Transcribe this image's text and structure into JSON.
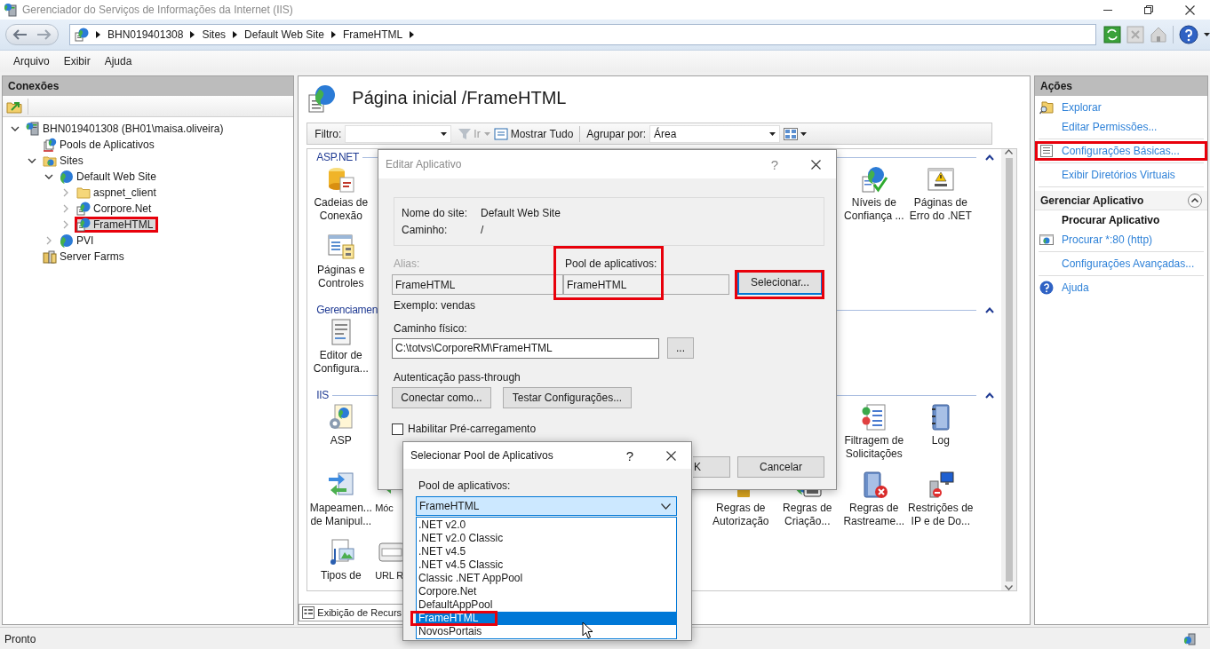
{
  "window": {
    "title": "Gerenciador do Serviços de Informações da Internet (IIS)"
  },
  "address_bar": {
    "breadcrumb": [
      "BHN019401308",
      "Sites",
      "Default Web Site",
      "FrameHTML"
    ]
  },
  "menu": [
    "Arquivo",
    "Exibir",
    "Ajuda"
  ],
  "connections": {
    "title": "Conexões",
    "tree": [
      {
        "label": "BHN019401308 (BH01\\maisa.oliveira)",
        "kind": "server",
        "expanded": true,
        "selected": false,
        "highlighted": false,
        "children": [
          {
            "label": "Pools de Aplicativos",
            "kind": "pools",
            "selected": false,
            "highlighted": false
          },
          {
            "label": "Sites",
            "kind": "sites",
            "expanded": true,
            "selected": false,
            "highlighted": false,
            "children": [
              {
                "label": "Default Web Site",
                "kind": "site",
                "expanded": true,
                "selected": false,
                "highlighted": false,
                "children": [
                  {
                    "label": "aspnet_client",
                    "kind": "folder",
                    "expanded": false,
                    "selected": false,
                    "highlighted": false
                  },
                  {
                    "label": "Corpore.Net",
                    "kind": "app",
                    "expanded": false,
                    "selected": false,
                    "highlighted": false
                  },
                  {
                    "label": "FrameHTML",
                    "kind": "app",
                    "expanded": false,
                    "selected": true,
                    "highlighted": true
                  }
                ]
              },
              {
                "label": "PVI",
                "kind": "site",
                "expanded": false,
                "selected": false,
                "highlighted": false
              }
            ]
          },
          {
            "label": "Server Farms",
            "kind": "farms",
            "selected": false,
            "highlighted": false
          }
        ]
      }
    ]
  },
  "features": {
    "title": "Página inicial /FrameHTML",
    "filter": {
      "label": "Filtro:",
      "go": {
        "label": "Ir",
        "disabled": true
      },
      "show_all": "Mostrar Tudo",
      "group_by_label": "Agrupar por:",
      "group_by_value": "Área"
    },
    "groups": [
      {
        "title": "ASP.NET",
        "expanded": true,
        "items": [
          {
            "label": "Cadeias de\nConexão",
            "kind": "connection-strings"
          },
          {
            "label": "Níveis de\nConfiança ...",
            "kind": "trust"
          },
          {
            "label": "Páginas de\nErro do .NET",
            "kind": "error-pages"
          },
          {
            "label": "Páginas e\nControles",
            "kind": "pages"
          }
        ]
      },
      {
        "title": "Gerenciamen",
        "expanded": true,
        "items": [
          {
            "label": "Editor de\nConfigura...",
            "kind": "config-editor"
          }
        ]
      },
      {
        "title": "IIS",
        "expanded": true,
        "items": [
          {
            "label": "ASP",
            "kind": "asp"
          },
          {
            "label": "Filtragem de\nSolicitações",
            "kind": "request-filtering"
          },
          {
            "label": "Log",
            "kind": "log"
          },
          {
            "label": "Mapeamen...\nde Manipul...",
            "kind": "handler-mappings"
          },
          {
            "label": "Móc",
            "kind": "modules"
          },
          {
            "label": "Regras de\nAutorização",
            "kind": "authorization"
          },
          {
            "label": "Regras de\nCriação...",
            "kind": "webdav"
          },
          {
            "label": "Regras de\nRastreame...",
            "kind": "failed-requests"
          },
          {
            "label": "Restrições de\nIP e de Do...",
            "kind": "ip-restrictions"
          },
          {
            "label": "Tipos de",
            "kind": "mime-types"
          },
          {
            "label": "URL R",
            "kind": "url-rewrite"
          }
        ]
      }
    ],
    "view_tabs": [
      {
        "label": "Exibição de Recurs",
        "selected": true
      }
    ]
  },
  "actions": {
    "title": "Ações",
    "sections": [
      {
        "items": [
          {
            "label": "Explorar",
            "kind": "link",
            "highlighted": false,
            "divider_after": false
          },
          {
            "label": "Editar Permissões...",
            "kind": "link",
            "highlighted": false,
            "divider_after": true
          },
          {
            "label": "Configurações Básicas...",
            "kind": "link",
            "highlighted": true,
            "divider_after": true
          },
          {
            "label": "Exibir Diretórios Virtuais",
            "kind": "link",
            "highlighted": false,
            "divider_after": true
          }
        ]
      },
      {
        "title": "Gerenciar Aplicativo",
        "expanded": true,
        "items": [
          {
            "label": "Procurar Aplicativo",
            "kind": "heading",
            "highlighted": false,
            "divider_after": false
          },
          {
            "label": "Procurar *:80 (http)",
            "kind": "link",
            "highlighted": false,
            "divider_after": true
          },
          {
            "label": "Configurações Avançadas...",
            "kind": "link",
            "highlighted": false,
            "divider_after": true
          }
        ]
      },
      {
        "items": [
          {
            "label": "Ajuda",
            "kind": "link",
            "highlighted": false,
            "divider_after": false
          }
        ]
      }
    ]
  },
  "edit_dialog": {
    "title": "Editar Aplicativo",
    "active": false,
    "help_button": "?",
    "site_name_label": "Nome do site:",
    "site_name": "Default Web Site",
    "path_label": "Caminho:",
    "path": "/",
    "alias_label": "Alias:",
    "alias": "FrameHTML",
    "alias_disabled": true,
    "pool_label": "Pool de aplicativos:",
    "pool": "FrameHTML",
    "pool_highlighted": true,
    "select_button": {
      "label": "Selecionar...",
      "focused": true,
      "highlighted": true
    },
    "example": "Exemplo: vendas",
    "physical_path_label": "Caminho físico:",
    "physical_path": "C:\\totvs\\CorporeRM\\FrameHTML",
    "browse_button": "...",
    "auth_label": "Autenticação pass-through",
    "connect_button": "Conectar como...",
    "test_button": "Testar Configurações...",
    "preload": {
      "label": "Habilitar Pré-carregamento",
      "checked": false
    },
    "ok_button": "K",
    "cancel_button": "Cancelar"
  },
  "select_dialog": {
    "title": "Selecionar Pool de Aplicativos",
    "active": true,
    "help_button": "?",
    "pool_label": "Pool de aplicativos:",
    "combo_value": "FrameHTML",
    "options": [
      {
        "label": ".NET v2.0",
        "selected": false,
        "highlighted": false
      },
      {
        "label": ".NET v2.0 Classic",
        "selected": false,
        "highlighted": false
      },
      {
        "label": ".NET v4.5",
        "selected": false,
        "highlighted": false
      },
      {
        "label": ".NET v4.5 Classic",
        "selected": false,
        "highlighted": false
      },
      {
        "label": "Classic .NET AppPool",
        "selected": false,
        "highlighted": false
      },
      {
        "label": "Corpore.Net",
        "selected": false,
        "highlighted": false
      },
      {
        "label": "DefaultAppPool",
        "selected": false,
        "highlighted": false
      },
      {
        "label": "FrameHTML",
        "selected": true,
        "highlighted": true
      },
      {
        "label": "NovosPortais",
        "selected": false,
        "highlighted": false
      }
    ]
  },
  "status_bar": {
    "text": "Pronto"
  }
}
